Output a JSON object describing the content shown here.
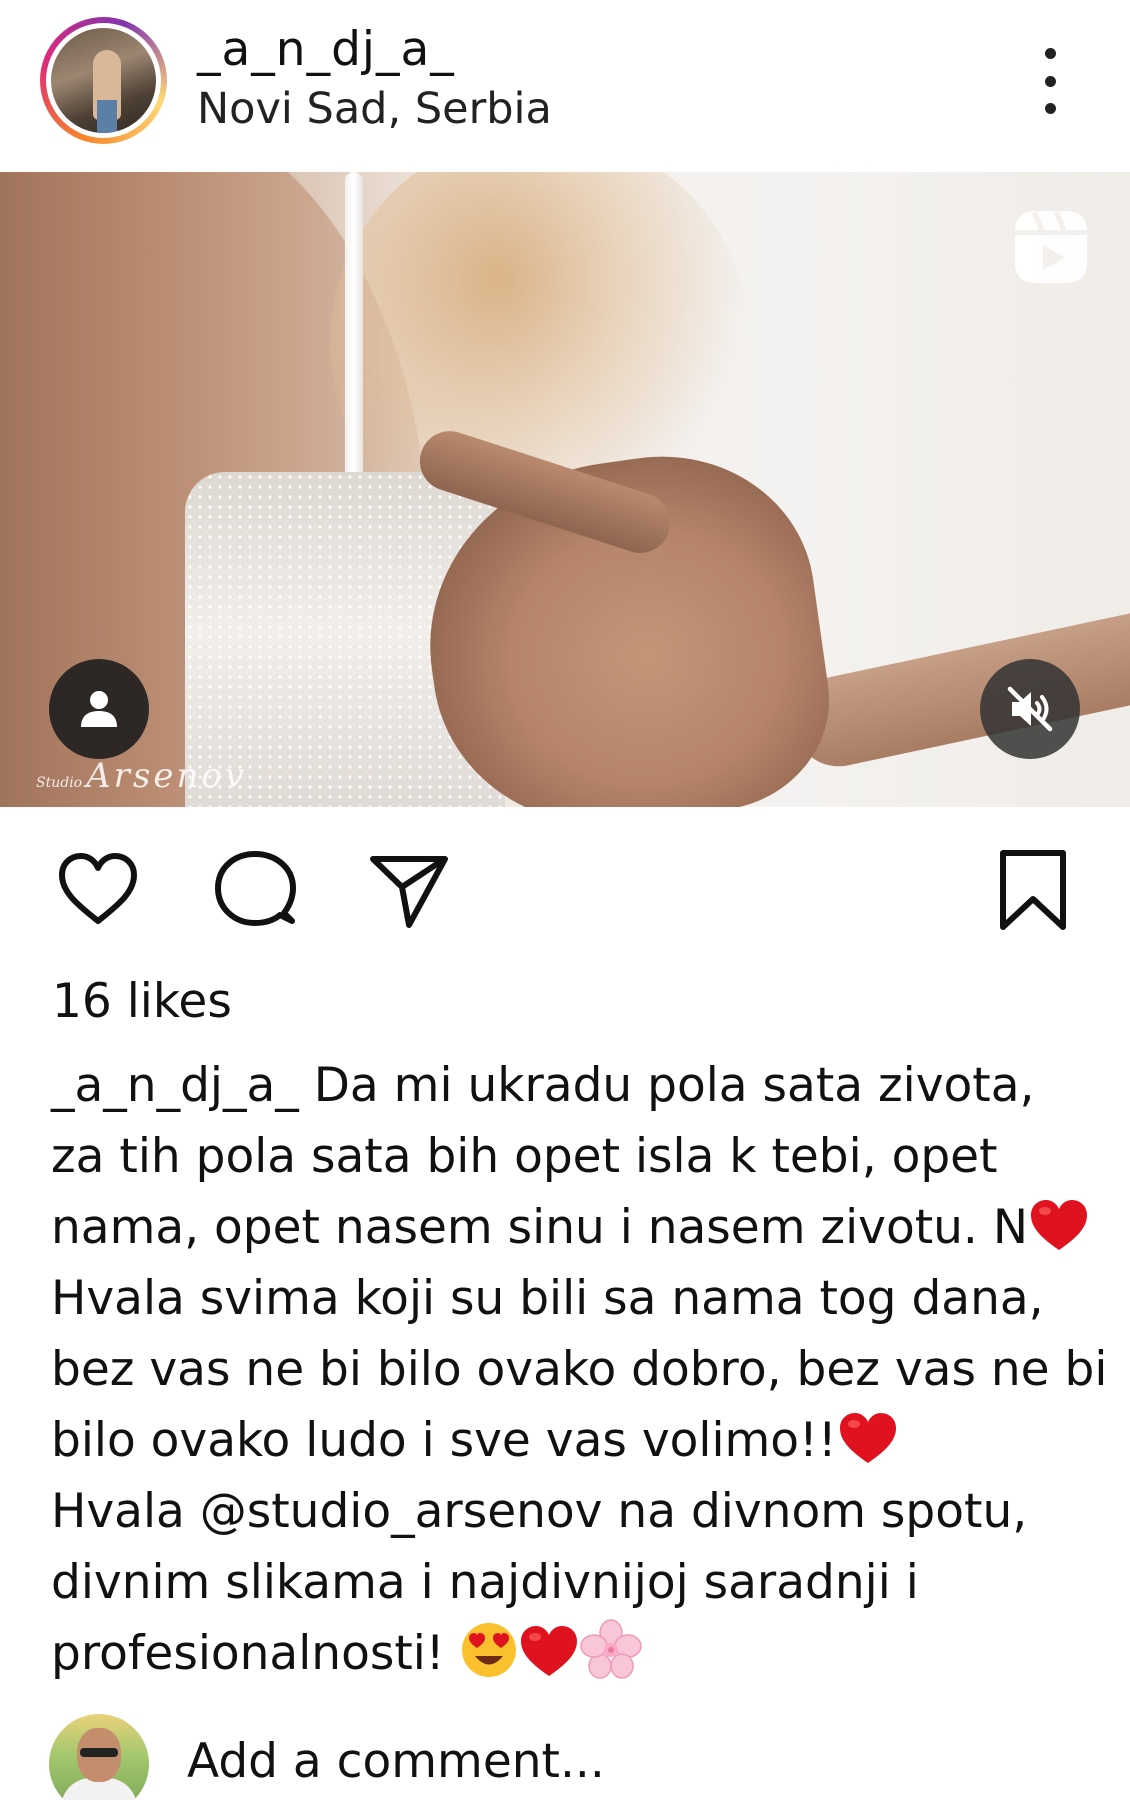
{
  "post": {
    "username": "_a_n_dj_a_",
    "location": "Novi Sad, Serbia"
  },
  "media": {
    "watermark_prefix": "Studio",
    "watermark_name": "Arsenov",
    "icons": [
      "reels-icon",
      "user-tag-icon",
      "mute-icon"
    ]
  },
  "actions": {
    "icons": [
      "heart-icon",
      "comment-icon",
      "share-icon",
      "bookmark-icon"
    ]
  },
  "likes": "16 likes",
  "caption": {
    "username": "_a_n_dj_a_",
    "line1": " Da mi ukradu pola sata zivota,",
    "line2": "za tih pola sata bih opet isla k tebi, opet",
    "line3": "nama, opet nasem sinu i nasem zivotu. N",
    "line4": "Hvala svima koji su bili sa nama tog dana,",
    "line5": "bez vas ne bi bilo ovako dobro, bez vas ne bi",
    "line6": "bilo ovako ludo  i sve vas volimo!!",
    "line7": "Hvala @studio_arsenov na divnom spotu,",
    "line8": "divnim slikama i najdivnijoj saradnji i",
    "line9": "profesionalnosti! ",
    "emojis": [
      "red-heart",
      "red-heart",
      "heart-eyes-face",
      "red-heart",
      "cherry-blossom"
    ]
  },
  "comment": {
    "placeholder": "Add a comment..."
  },
  "colors": {
    "text": "#111111",
    "heart_red": "#e0121f",
    "ring_orange": "#f58529",
    "ring_pink": "#dd2a7b",
    "ring_purple": "#8134af"
  }
}
